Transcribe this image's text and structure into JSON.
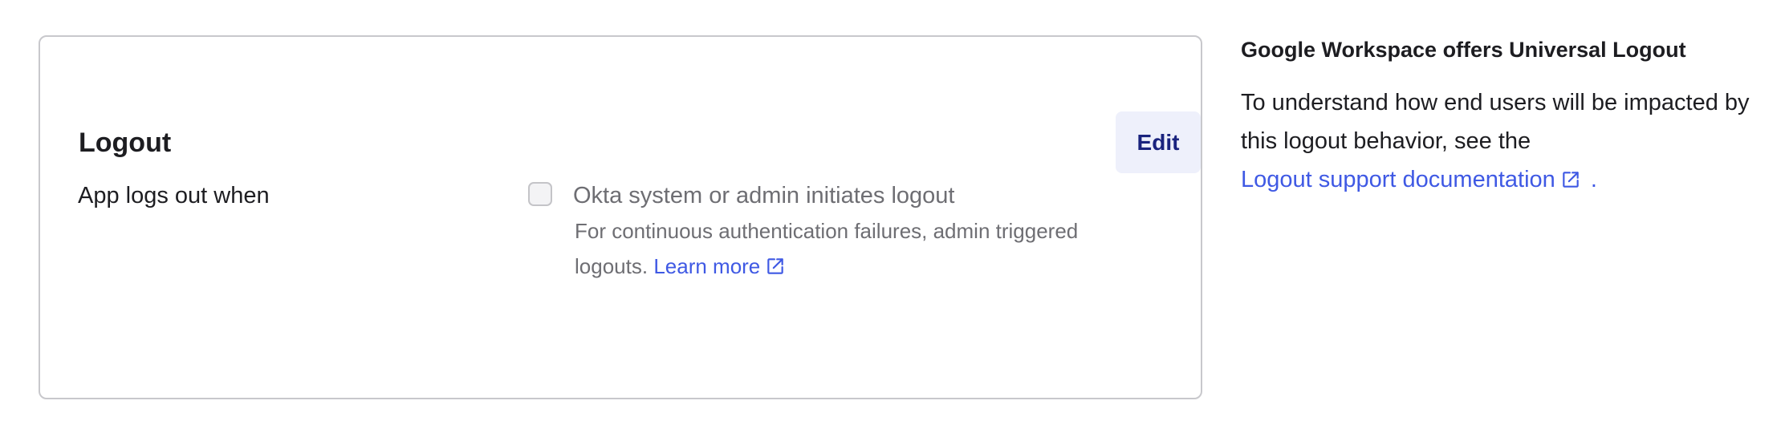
{
  "logout_card": {
    "title": "Logout",
    "edit_label": "Edit",
    "row_label": "App logs out when",
    "option": {
      "label": "Okta system or admin initiates logout",
      "checked": false,
      "description": "For continuous authentication failures, admin triggered logouts.",
      "learn_more": "Learn more",
      "learn_more_icon": "external-link-icon"
    }
  },
  "aside": {
    "title": "Google Workspace offers Universal Logout",
    "text": "To understand how end users will be impacted by this logout behavior, see the",
    "link_label": "Logout support documentation",
    "link_icon": "external-link-icon",
    "trailing": "."
  },
  "colors": {
    "link": "#3f59e4",
    "edit_button_bg": "#eef0fb",
    "edit_button_text": "#1a237e",
    "card_border": "#c8c8cc",
    "muted_text": "#6e6e73"
  }
}
